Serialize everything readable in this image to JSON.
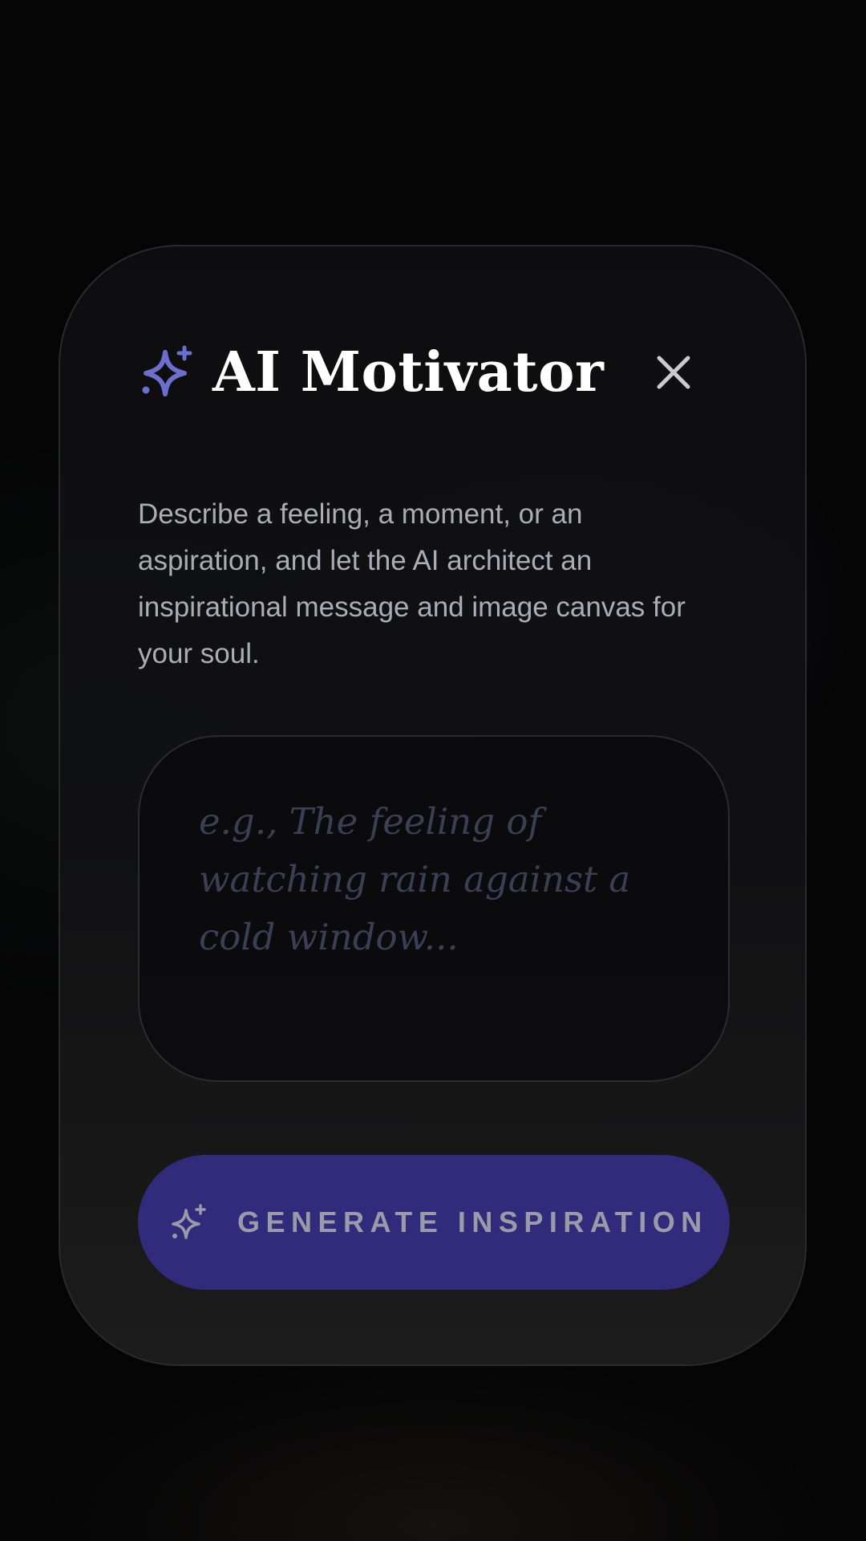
{
  "modal": {
    "title": "AI Motivator",
    "description": "Describe a feeling, a moment, or an aspiration, and let the AI architect an inspirational message and image canvas for your soul.",
    "close_icon": "close-icon",
    "title_icon": "sparkles-icon"
  },
  "prompt": {
    "value": "",
    "placeholder": "e.g., The feeling of watching rain against a cold window..."
  },
  "generate_button": {
    "label": "GENERATE INSPIRATION",
    "icon": "sparkles-icon"
  },
  "colors": {
    "accent": "#6b6fd0",
    "button_bg": "#322b7c",
    "card_border": "#2a2a2c",
    "page_bg": "#050506"
  }
}
